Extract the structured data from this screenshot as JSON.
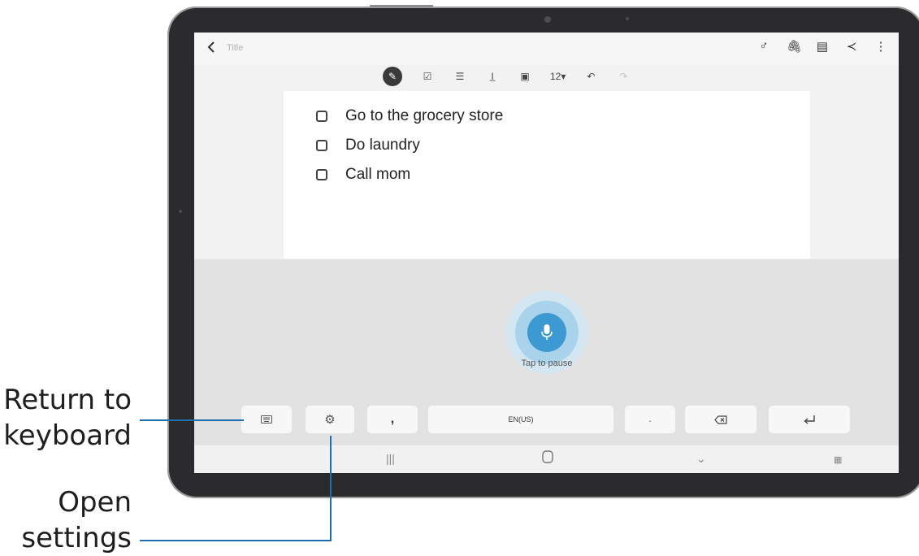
{
  "callouts": {
    "return_to_keyboard": [
      "Return to",
      "keyboard"
    ],
    "open_settings": [
      "Open",
      "settings"
    ]
  },
  "colors": {
    "accent": "#3c99d2",
    "callout_line": "#1f6fb0"
  },
  "app": {
    "back_icon": "chevron-left-icon",
    "title": "Title",
    "top_actions": [
      "pen-mode-icon",
      "attachment-icon",
      "template-icon",
      "share-icon",
      "more-icon"
    ]
  },
  "toolbar": {
    "items": [
      "handwriting-icon",
      "checkbox-icon",
      "text-style-icon",
      "text-format-icon",
      "text-box-icon",
      "font-size",
      "undo-icon",
      "redo-icon"
    ],
    "font_size": "12▾"
  },
  "note": {
    "checklist": [
      "Go to the grocery store",
      "Do laundry",
      "Call mom"
    ]
  },
  "voice": {
    "mic_icon": "microphone-icon",
    "status": "Tap to pause"
  },
  "keys": {
    "keyboard_icon": "keyboard-icon",
    "settings_icon": "settings-gear-icon",
    "comma": ",",
    "language": "EN(US)",
    "period": ".",
    "backspace_icon": "backspace-icon",
    "enter_icon": "enter-icon"
  },
  "navbar": [
    "recents-icon",
    "home-icon",
    "hide-keyboard-icon",
    "keyboard-switch-icon"
  ]
}
